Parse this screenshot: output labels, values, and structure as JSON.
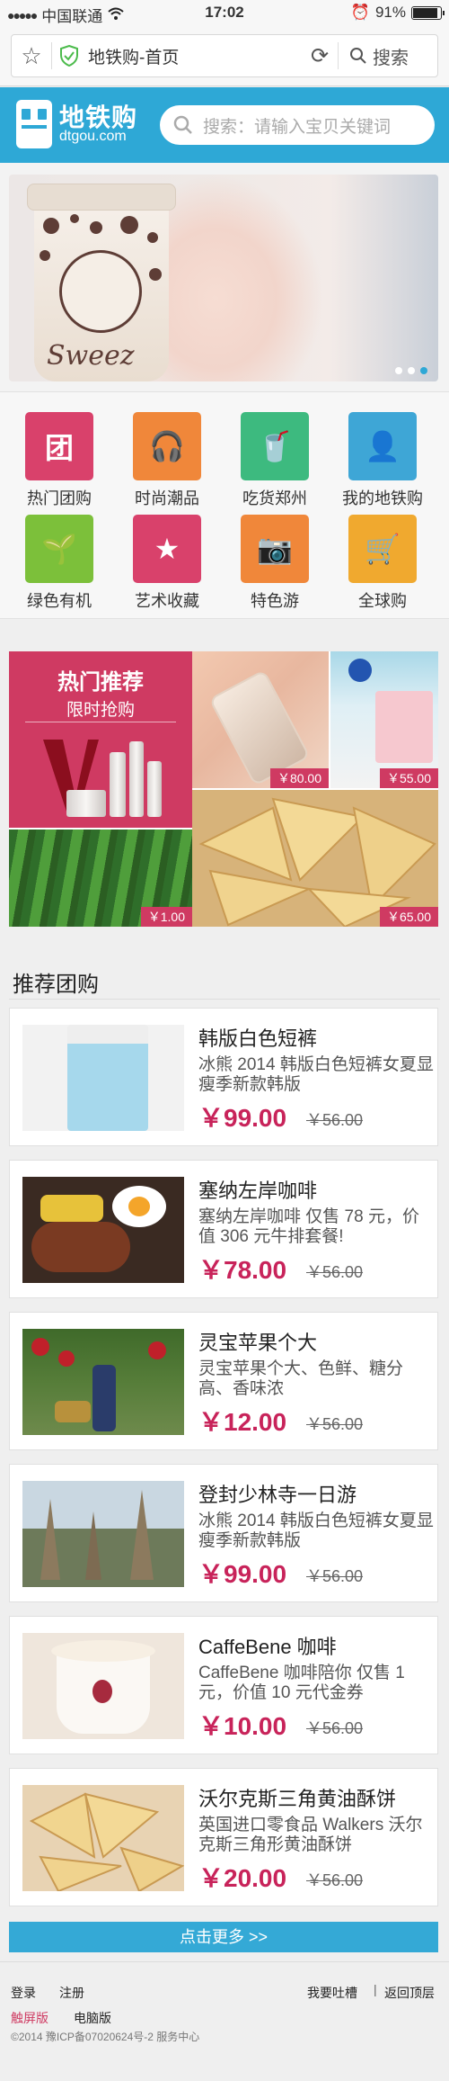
{
  "status_bar": {
    "carrier": "中国联通",
    "time": "17:02",
    "battery": "91%",
    "battery_level": 0.91
  },
  "browser": {
    "url_title": "地铁购-首页",
    "search_label": "搜索"
  },
  "header": {
    "logo_title": "地铁购",
    "logo_sub": "dtgou.com",
    "search_placeholder": "搜索：请输入宝贝关键词"
  },
  "banner": {
    "brand_text": "Sweez",
    "dots": 3,
    "active_dot": 3
  },
  "categories": [
    {
      "label": "热门团购",
      "glyph": "团",
      "color": "#d9416b",
      "icon": "group-buy-icon"
    },
    {
      "label": "时尚潮品",
      "glyph": "🎧",
      "color": "#f0873a",
      "icon": "headphones-icon"
    },
    {
      "label": "吃货郑州",
      "glyph": "🥤",
      "color": "#3dba7f",
      "icon": "drink-icon"
    },
    {
      "label": "我的地铁购",
      "glyph": "👤",
      "color": "#3ea6d6",
      "icon": "user-icon"
    },
    {
      "label": "绿色有机",
      "glyph": "🌱",
      "color": "#7cc03a",
      "icon": "sprout-icon"
    },
    {
      "label": "艺术收藏",
      "glyph": "★",
      "color": "#d9416b",
      "icon": "star-icon"
    },
    {
      "label": "特色游",
      "glyph": "📷",
      "color": "#f0873a",
      "icon": "camera-icon"
    },
    {
      "label": "全球购",
      "glyph": "🛒",
      "color": "#f0a92f",
      "icon": "stroller-icon"
    }
  ],
  "promo": {
    "title": "热门推荐",
    "subtitle": "限时抢购",
    "tiles": [
      {
        "price": "￥80.00",
        "name": "phone-case-tile"
      },
      {
        "price": "￥55.00",
        "name": "shorts-tile"
      },
      {
        "price": "￥1.00",
        "name": "watermelon-tile"
      },
      {
        "price": "￥65.00",
        "name": "biscuit-tile"
      }
    ]
  },
  "section_title": "推荐团购",
  "products": [
    {
      "title": "韩版白色短裤",
      "desc": "冰熊 2014 韩版白色短裤女夏显瘦季新款韩版",
      "price": "￥99.00",
      "old_price": "￥56.00",
      "img": "shorts"
    },
    {
      "title": "塞纳左岸咖啡",
      "desc": "塞纳左岸咖啡 仅售 78 元，价值 306 元牛排套餐!",
      "price": "￥78.00",
      "old_price": "￥56.00",
      "img": "steak"
    },
    {
      "title": "灵宝苹果个大",
      "desc": "灵宝苹果个大、色鲜、糖分高、香味浓",
      "price": "￥12.00",
      "old_price": "￥56.00",
      "img": "apple"
    },
    {
      "title": "登封少林寺一日游",
      "desc": "冰熊 2014 韩版白色短裤女夏显瘦季新款韩版",
      "price": "￥99.00",
      "old_price": "￥56.00",
      "img": "pagoda"
    },
    {
      "title": "CaffeBene 咖啡",
      "desc": "CaffeBene 咖啡陪你 仅售 1 元，价值 10 元代金券",
      "price": "￥10.00",
      "old_price": "￥56.00",
      "img": "coffee"
    },
    {
      "title": "沃尔克斯三角黄油酥饼",
      "desc": "英国进口零食品 Walkers 沃尔克斯三角形黄油酥饼",
      "price": "￥20.00",
      "old_price": "￥56.00",
      "img": "biscuit"
    }
  ],
  "more_label": "点击更多 >>",
  "footer": {
    "login": "登录",
    "register": "注册",
    "feedback": "我要吐槽",
    "separator": "|",
    "back_top": "返回顶层",
    "touch": "触屏版",
    "pc": "电脑版",
    "copyright": "©2014 豫ICP备07020624号-2 服务中心"
  }
}
